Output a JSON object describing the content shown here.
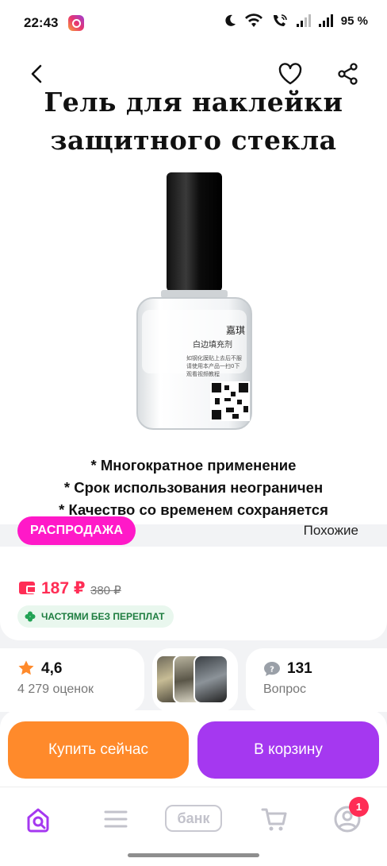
{
  "status_bar": {
    "time": "22:43",
    "battery": "95 %",
    "icons": [
      "instagram-icon",
      "moon-icon",
      "wifi-icon",
      "wifi-call-icon",
      "signal-icon",
      "signal-icon",
      "battery-icon"
    ]
  },
  "product": {
    "title_line1": "Гель для наклейки",
    "title_line2": "защитного стекла",
    "bullets": [
      "* Многократное применение",
      "* Срок использования неограничен",
      "* Качество со временем сохраняется"
    ],
    "bottle_label_text": [
      "嘉琪",
      "白边填充剂",
      "如钢化膜贴上去后不服",
      "请使用本产品一扫0下",
      "观看视频教程"
    ]
  },
  "header_actions": {
    "back_icon": "chevron-left-icon",
    "favorite_icon": "heart-icon",
    "share_icon": "share-icon"
  },
  "sale": {
    "badge": "РАСПРОДАЖА",
    "similar": "Похожие"
  },
  "price": {
    "current": "187 ₽",
    "old": "380 ₽",
    "installment": "ЧАСТЯМИ БЕЗ ПЕРЕПЛАТ"
  },
  "stats": {
    "rating": "4,6",
    "reviews": "4 279 оценок",
    "questions_count": "131",
    "questions_label": "Вопрос"
  },
  "actions": {
    "buy_now": "Купить сейчас",
    "add_to_cart": "В корзину"
  },
  "bottom_nav": {
    "bank_label": "банк",
    "notification_count": "1"
  },
  "colors": {
    "sale_pink": "#ff19c8",
    "price_red": "#ff2d55",
    "buy_orange": "#ff8a2b",
    "cart_purple": "#a538f0",
    "installment_green": "#1e7d40",
    "nav_active": "#a538f0"
  }
}
